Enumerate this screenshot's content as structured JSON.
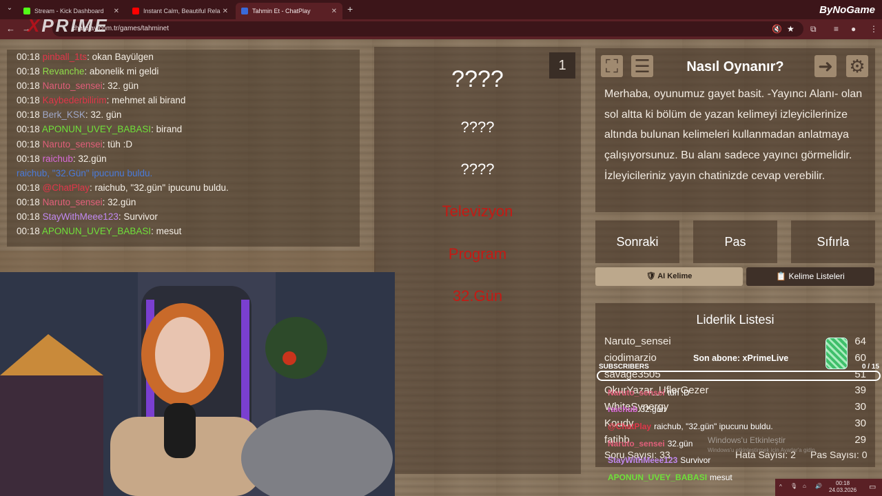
{
  "browser": {
    "tabs": [
      {
        "title": "Stream - Kick Dashboard",
        "color": "#53fc18"
      },
      {
        "title": "Instant Calm, Beautiful Rela",
        "color": "#ff0000"
      },
      {
        "title": "Tahmin Et - ChatPlay",
        "color": "#3a6ad9"
      }
    ],
    "url": "chatplay.com.tr/games/tahminet",
    "brand": "ByNoGame",
    "overlay_logo_x": "X",
    "overlay_logo": "PRIME"
  },
  "chat": [
    {
      "time": "00:18",
      "user": "pinball_1ts",
      "color": "#e0364a",
      "msg": ": okan Bayülgen"
    },
    {
      "time": "00:18",
      "user": "Revanche",
      "color": "#8fdc4a",
      "msg": ": abonelik mi geldi"
    },
    {
      "time": "00:18",
      "user": "Naruto_sensei",
      "color": "#e05f7a",
      "msg": ": 32. gün"
    },
    {
      "time": "00:18",
      "user": "Kaybederbilirim",
      "color": "#e0364a",
      "msg": ": mehmet ali birand"
    },
    {
      "time": "00:18",
      "user": "Berk_KSK",
      "color": "#a0a8c8",
      "msg": ": 32. gün"
    },
    {
      "time": "00:18",
      "user": "APONUN_UVEY_BABASI",
      "color": "#6fe03a",
      "msg": ": birand"
    },
    {
      "time": "00:18",
      "user": "Naruto_sensei",
      "color": "#e05f7a",
      "msg": ": tüh :D"
    },
    {
      "time": "00:18",
      "user": "raichub",
      "color": "#d96ad9",
      "msg": ": 32.gün"
    },
    {
      "time": "",
      "user": "raichub, \"32.Gün\" ipucunu buldu.",
      "color": "#4a7ad9",
      "msg": ""
    },
    {
      "time": "00:18",
      "user": "@ChatPlay",
      "color": "#e0364a",
      "msg": ": raichub, \"32.gün\" ipucunu buldu."
    },
    {
      "time": "00:18",
      "user": "Naruto_sensei",
      "color": "#e05f7a",
      "msg": ": 32.gün"
    },
    {
      "time": "00:18",
      "user": "StayWithMeee123",
      "color": "#c088f0",
      "msg": ": Survivor"
    },
    {
      "time": "00:18",
      "user": "APONUN_UVEY_BABASI",
      "color": "#6fe03a",
      "msg": ": mesut"
    }
  ],
  "game": {
    "round": "1",
    "words": [
      {
        "text": "????",
        "state": "hidden"
      },
      {
        "text": "????",
        "state": "hidden"
      },
      {
        "text": "????",
        "state": "hidden"
      },
      {
        "text": "Televizyon",
        "state": "reveal"
      },
      {
        "text": "Program",
        "state": "reveal"
      },
      {
        "text": "32.Gün",
        "state": "reveal"
      }
    ]
  },
  "howto": {
    "title": "Nasıl Oynanır?",
    "text": "Merhaba, oyunumuz gayet basit. -Yayıncı Alanı- olan sol altta ki bölüm de yazan kelimeyi izleyicilerinize altında bulunan kelimeleri kullanmadan anlatmaya çalışıyorsunuz. Bu alanı sadece yayıncı görmelidir. İzleyicileriniz yayın chatinizde cevap verebilir."
  },
  "controls": {
    "next": "Sonraki",
    "pass": "Pas",
    "reset": "Sıfırla",
    "ai_word": "AI Kelime",
    "word_lists": "Kelime Listeleri"
  },
  "leaderboard": {
    "title": "Liderlik Listesi",
    "rows": [
      {
        "name": "Naruto_sensei",
        "score": "64"
      },
      {
        "name": "ciodimarzio",
        "score": "60"
      },
      {
        "name": "savage3505",
        "score": "51"
      },
      {
        "name": "OkurYazar_UflerGezer",
        "score": "39"
      },
      {
        "name": "WhiteSynergy",
        "score": "30"
      },
      {
        "name": "Koudy",
        "score": "30"
      },
      {
        "name": "fatihb",
        "score": "29"
      }
    ],
    "questions": "Soru Sayısı: 33",
    "errors": "Hata Sayısı: 2",
    "passes": "Pas Sayısı: 0"
  },
  "overlay": {
    "subscribers_label": "SUBSCRIBERS",
    "subscribers_count": "0 / 15",
    "subscribers_progress": 0,
    "last_sub": "Son abone: xPrimeLive",
    "chat": [
      {
        "user": "Naruto_sensei",
        "color": "#e05f7a",
        "msg": "tüh :D"
      },
      {
        "user": "raichub",
        "color": "#d96ad9",
        "msg": "32.gün"
      },
      {
        "user": "@ChatPlay",
        "color": "#e0364a",
        "msg": "raichub, \"32.gün\" ipucunu buldu."
      },
      {
        "user": "Naruto_sensei",
        "color": "#e05f7a",
        "msg": "32.gün"
      },
      {
        "user": "StayWithMeee123",
        "color": "#c088f0",
        "msg": "Survivor"
      },
      {
        "user": "APONUN_UVEY_BABASI",
        "color": "#6fe03a",
        "msg": "mesut"
      }
    ],
    "windows_title": "Windows'u Etkinleştir",
    "windows_sub": "Windows'u etkinleştirmek için Ayarlar'a gidin."
  },
  "taskbar": {
    "time": "00:18",
    "date": "24.03.2026"
  }
}
